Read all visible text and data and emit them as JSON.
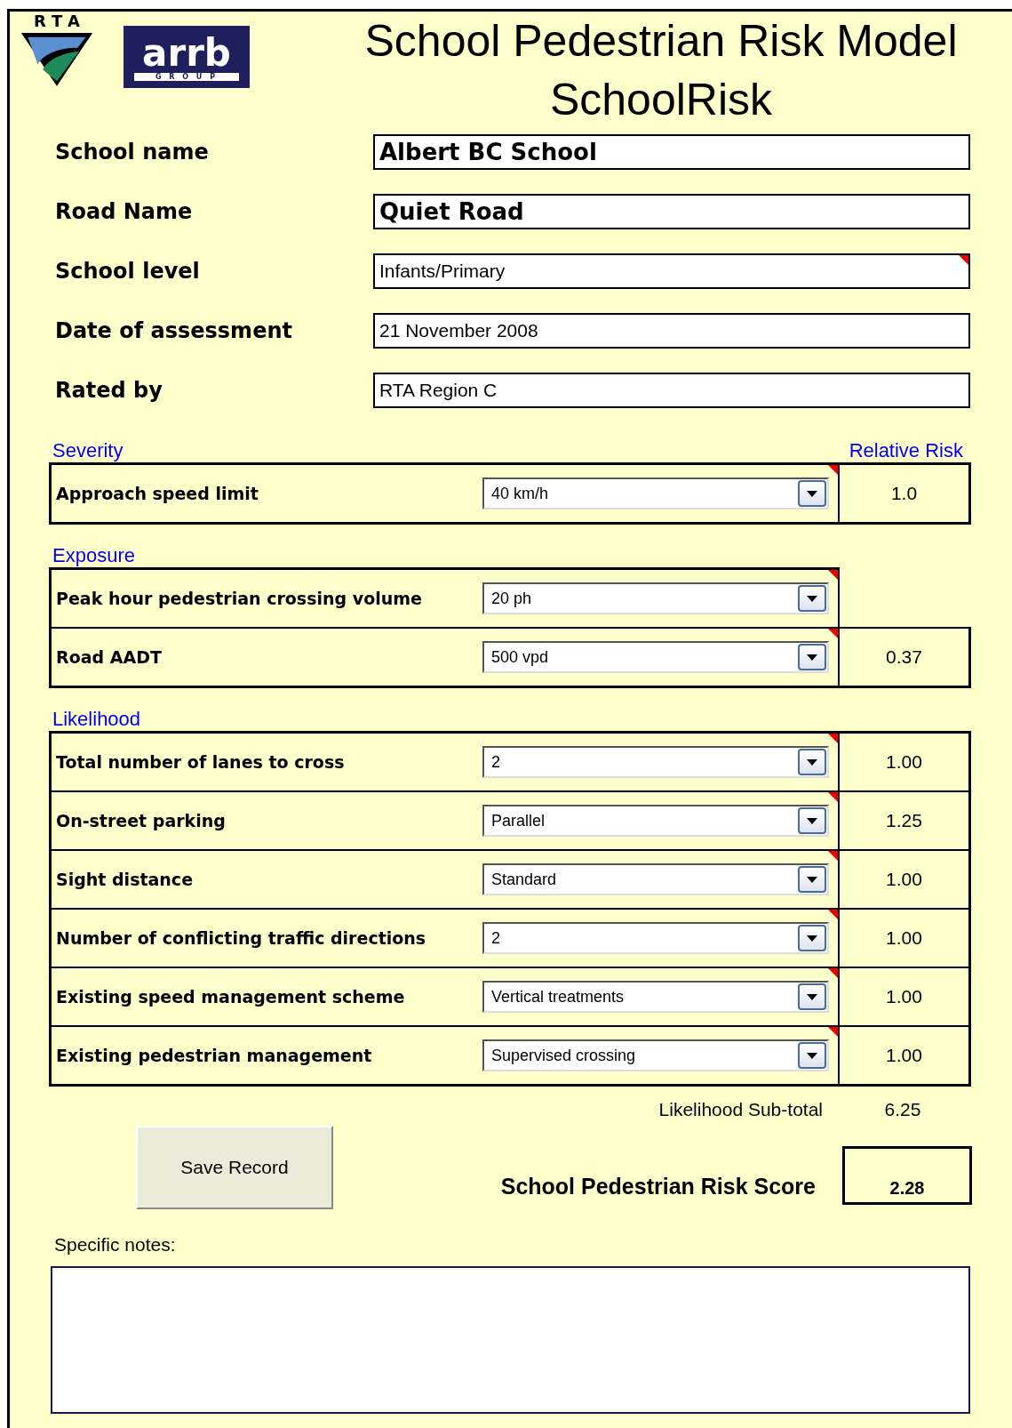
{
  "logos": {
    "rta": "RTA",
    "arrb": "arrb",
    "group": "G R O U P"
  },
  "title": [
    "School Pedestrian Risk Model",
    "SchoolRisk"
  ],
  "fields": [
    {
      "label": "School name",
      "value": "Albert BC School",
      "kind": "bold",
      "comment": false
    },
    {
      "label": "Road Name",
      "value": "Quiet Road",
      "kind": "bold",
      "comment": false
    },
    {
      "label": "School level",
      "value": "Infants/Primary",
      "kind": "plain",
      "comment": true
    },
    {
      "label": "Date of assessment",
      "value": "21 November 2008",
      "kind": "plain",
      "comment": false
    },
    {
      "label": "Rated by",
      "value": "RTA Region C",
      "kind": "plain",
      "comment": false
    }
  ],
  "sections": [
    {
      "heading": "Severity",
      "risk_heading": "Relative Risk",
      "rows": [
        {
          "label": "Approach speed limit",
          "value": "40 km/h",
          "risk": "1.0",
          "comment": true
        }
      ]
    },
    {
      "heading": "Exposure",
      "rows": [
        {
          "label": "Peak hour pedestrian crossing volume",
          "value": "20 ph",
          "comment": true
        },
        {
          "label": "Road AADT",
          "value": "500 vpd",
          "risk": "0.37",
          "comment": true
        }
      ]
    },
    {
      "heading": "Likelihood",
      "rows": [
        {
          "label": "Total number of lanes to cross",
          "value": "2",
          "risk": "1.00",
          "comment": true
        },
        {
          "label": "On-street parking",
          "value": "Parallel",
          "risk": "1.25",
          "comment": true
        },
        {
          "label": "Sight distance",
          "value": "Standard",
          "risk": "1.00",
          "comment": true
        },
        {
          "label": "Number of conflicting traffic directions",
          "value": "2",
          "risk": "1.00",
          "comment": true
        },
        {
          "label": "Existing speed management scheme",
          "value": "Vertical treatments",
          "risk": "1.00",
          "comment": true
        },
        {
          "label": "Existing pedestrian management",
          "value": "Supervised crossing",
          "risk": "1.00",
          "comment": true
        }
      ]
    }
  ],
  "subtotal": {
    "label": "Likelihood Sub-total",
    "value": "6.25"
  },
  "save_button": "Save Record",
  "score": {
    "label": "School Pedestrian Risk Score",
    "value": "2.28"
  },
  "notes": {
    "label": "Specific notes:"
  }
}
